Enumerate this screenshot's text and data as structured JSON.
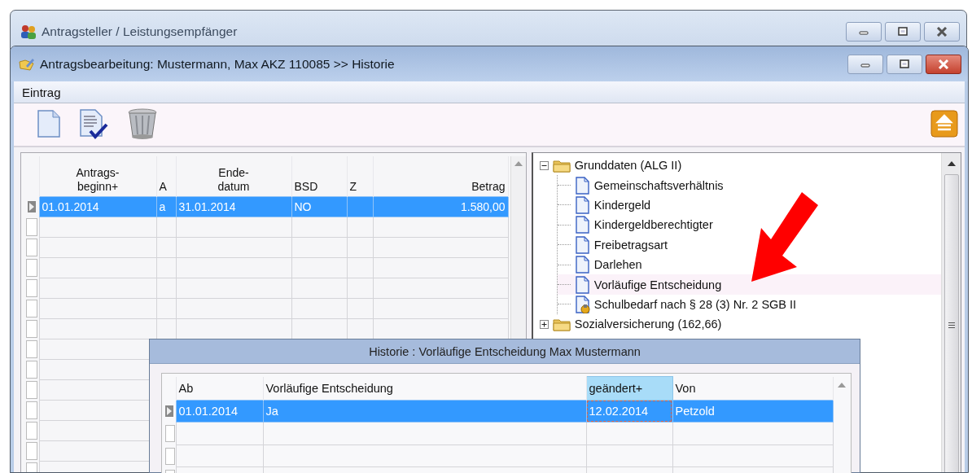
{
  "outer_window": {
    "title": "Antragsteller / Leistungsempfänger"
  },
  "window": {
    "title": "Antragsbearbeitung: Mustermann, Max AKZ 110085 >> Historie"
  },
  "menu": [
    "Eintrag"
  ],
  "grid": {
    "columns": [
      "Antrags-\nbeginn+",
      "A",
      "Ende-\ndatum",
      "BSD",
      "Z",
      "Betrag"
    ],
    "rows": [
      {
        "selected": true,
        "cells": [
          "01.01.2014",
          "a",
          "31.01.2014",
          "NO",
          null,
          "1.580,00"
        ]
      }
    ]
  },
  "tree": [
    {
      "label": "Grunddaten (ALG II)",
      "kind": "folder",
      "expanded": true,
      "selected": false,
      "children": [
        {
          "label": "Gemeinschaftsverhältnis",
          "kind": "page",
          "selected": false
        },
        {
          "label": "Kindergeld",
          "kind": "page",
          "selected": false
        },
        {
          "label": "Kindergeldberechtigter",
          "kind": "page",
          "selected": false
        },
        {
          "label": "Freibetragsart",
          "kind": "page",
          "selected": false
        },
        {
          "label": "Darlehen",
          "kind": "page",
          "selected": false
        },
        {
          "label": "Vorläufige Entscheidung",
          "kind": "page",
          "selected": true
        },
        {
          "label": "Schulbedarf nach § 28 (3) Nr. 2 SGB II",
          "kind": "page-key",
          "selected": false
        }
      ]
    },
    {
      "label": "Sozialversicherung (162,66)",
      "kind": "folder",
      "expanded": false,
      "selected": false
    }
  ],
  "history": {
    "title": "Historie : Vorläufige Entscheidung Max Mustermann",
    "columns": [
      {
        "label": "Ab",
        "sorted": false
      },
      {
        "label": "Vorläufige Entscheidung",
        "sorted": false
      },
      {
        "label": "geändert+",
        "sorted": true
      },
      {
        "label": "Von",
        "sorted": false
      }
    ],
    "rows": [
      {
        "selected": true,
        "cells": [
          {
            "text": "01.01.2014",
            "focused": false
          },
          {
            "text": "Ja",
            "focused": false
          },
          {
            "text": "12.02.2014",
            "focused": true
          },
          {
            "text": "Petzold",
            "focused": false
          }
        ]
      }
    ]
  }
}
